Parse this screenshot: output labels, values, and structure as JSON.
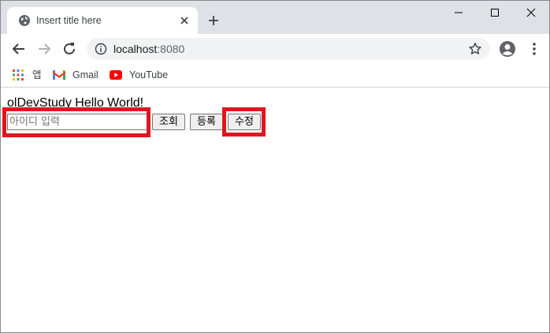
{
  "browser": {
    "tab_title": "Insert title here",
    "url_host": "localhost",
    "url_port": ":8080",
    "bookmarks": [
      {
        "label": "앱",
        "icon": "apps-grid-icon"
      },
      {
        "label": "Gmail",
        "icon": "gmail-icon"
      },
      {
        "label": "YouTube",
        "icon": "youtube-icon"
      }
    ]
  },
  "page": {
    "heading": "olDevStudy Hello World!",
    "id_input": {
      "placeholder": "아이디 입력",
      "value": ""
    },
    "buttons": {
      "search": "조회",
      "register": "등록",
      "edit": "수정"
    }
  },
  "colors": {
    "highlight": "#e0161e",
    "tabstrip": "#dee1e6",
    "omnibox": "#f1f3f4"
  }
}
